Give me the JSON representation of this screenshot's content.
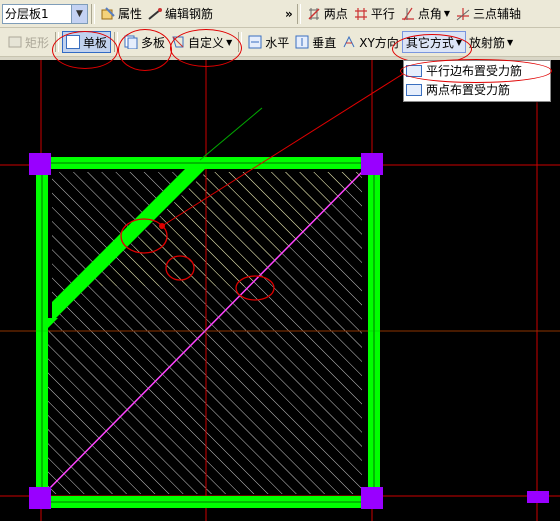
{
  "toolbar1": {
    "layer_select": "分层板1",
    "properties_label": "属性",
    "edit_rebar_label": "编辑钢筋",
    "two_point_label": "两点",
    "parallel_label": "平行",
    "point_angle_label": "点角",
    "three_point_axis_label": "三点辅轴"
  },
  "toolbar2": {
    "rect_label": "矩形",
    "single_board_label": "单板",
    "multi_board_label": "多板",
    "custom_label": "自定义",
    "horizontal_label": "水平",
    "vertical_label": "垂直",
    "xy_direction_label": "XY方向",
    "other_methods_label": "其它方式",
    "radial_rebar_label": "放射筋"
  },
  "menu": {
    "items": [
      {
        "label": "平行边布置受力筋"
      },
      {
        "label": "两点布置受力筋"
      }
    ]
  },
  "colors": {
    "beam_green": "#00ff00",
    "column_purple": "#9900ff",
    "axis_red": "#cc0000",
    "annotation_red": "#e00000",
    "hatch_white": "#ffffff",
    "diagonal_magenta": "#ff44ff",
    "hatch_yellow": "#ffff99"
  }
}
